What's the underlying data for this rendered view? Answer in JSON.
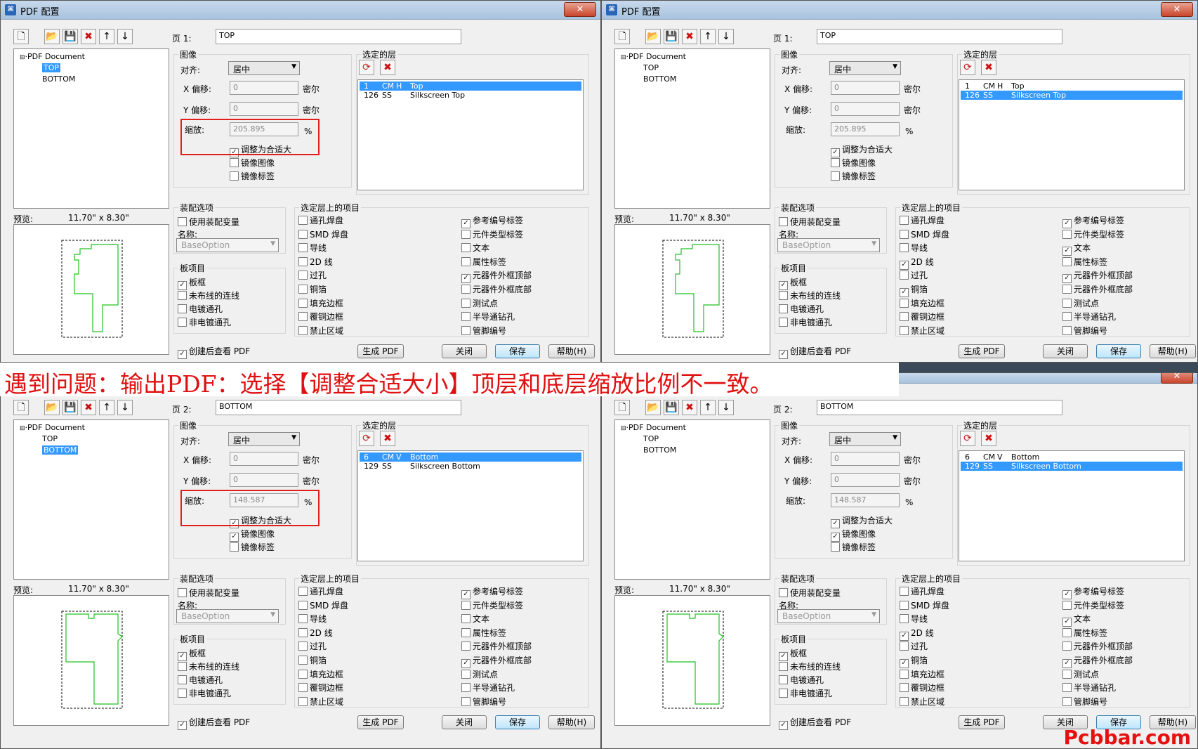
{
  "window": {
    "title": "PDF 配置",
    "close": "✕"
  },
  "banner": "遇到问题：输出PDF：选择【调整合适大小】顶层和底层缩放比例不一致。",
  "watermark": "Pcbbar.com",
  "labels": {
    "image": "图像",
    "align": "对齐:",
    "xoff": "X 偏移:",
    "yoff": "Y 偏移:",
    "unit": "密尔",
    "scale": "缩放:",
    "pct": "%",
    "fit": "调整为合适大",
    "mirror_img": "镜像图像",
    "mirror_lbl": "镜像标签",
    "layers": "选定的层",
    "asm": "装配选项",
    "asm_var": "使用装配变量",
    "name": "名称:",
    "board": "板项目",
    "items": "选定层上的项目",
    "preview": "预览:",
    "view_after": "创建后查看 PDF",
    "gen": "生成 PDF",
    "close": "关闭",
    "save": "保存",
    "help": "帮助(H)",
    "align_value": "居中",
    "base_option": "BaseOption",
    "tree_root": "PDF Document",
    "tree_top": "TOP",
    "tree_bottom": "BOTTOM"
  },
  "board_items": [
    "板框",
    "未布线的连线",
    "电镀通孔",
    "非电镀通孔"
  ],
  "item_col1": [
    "通孔焊盘",
    "SMD 焊盘",
    "导线",
    "2D 线",
    "过孔",
    "铜箔",
    "填充边框",
    "覆铜边框",
    "禁止区域"
  ],
  "item_col2": [
    "参考编号标签",
    "元件类型标签",
    "文本",
    "属性标签",
    "元器件外框顶部",
    "元器件外框底部",
    "测试点",
    "半导通钻孔",
    "管脚编号"
  ],
  "dialogs": [
    {
      "page_label": "页 1:",
      "page_value": "TOP",
      "tree_sel": "top",
      "size": "11.70\" x 8.30\"",
      "x_off": "0",
      "y_off": "0",
      "scale": "205.895",
      "fit": true,
      "mirror_img": false,
      "mirror_lbl": false,
      "layers": [
        {
          "num": "1",
          "code": "CM",
          "dir": "H",
          "name": "Top",
          "sel": true
        },
        {
          "num": "126",
          "code": "SS",
          "dir": "",
          "name": "Silkscreen Top",
          "sel": false
        }
      ],
      "board_checks": [
        true,
        false,
        false,
        false
      ],
      "col1_checks": [
        false,
        false,
        false,
        false,
        false,
        false,
        false,
        false,
        false
      ],
      "col2_checks": [
        true,
        false,
        false,
        false,
        true,
        false,
        false,
        false,
        false
      ],
      "highlight": true,
      "preview_mirror": false
    },
    {
      "page_label": "页 1:",
      "page_value": "TOP",
      "tree_sel": "none",
      "size": "11.70\" x 8.30\"",
      "x_off": "0",
      "y_off": "0",
      "scale": "205.895",
      "fit": true,
      "mirror_img": false,
      "mirror_lbl": false,
      "layers": [
        {
          "num": "1",
          "code": "CM",
          "dir": "H",
          "name": "Top",
          "sel": false
        },
        {
          "num": "126",
          "code": "SS",
          "dir": "",
          "name": "Silkscreen Top",
          "sel": true
        }
      ],
      "board_checks": [
        true,
        false,
        false,
        false
      ],
      "col1_checks": [
        false,
        false,
        false,
        true,
        false,
        true,
        false,
        false,
        false
      ],
      "col2_checks": [
        true,
        false,
        true,
        false,
        true,
        false,
        false,
        false,
        false
      ],
      "highlight": false,
      "preview_mirror": false
    },
    {
      "page_label": "页 2:",
      "page_value": "BOTTOM",
      "tree_sel": "bottom",
      "size": "11.70\" x 8.30\"",
      "x_off": "0",
      "y_off": "0",
      "scale": "148.587",
      "fit": true,
      "mirror_img": true,
      "mirror_lbl": false,
      "layers": [
        {
          "num": "6",
          "code": "CM",
          "dir": "V",
          "name": "Bottom",
          "sel": true
        },
        {
          "num": "129",
          "code": "SS",
          "dir": "",
          "name": "Silkscreen Bottom",
          "sel": false
        }
      ],
      "board_checks": [
        true,
        false,
        false,
        false
      ],
      "col1_checks": [
        false,
        false,
        false,
        false,
        false,
        false,
        false,
        false,
        false
      ],
      "col2_checks": [
        true,
        false,
        false,
        false,
        false,
        true,
        false,
        false,
        false
      ],
      "highlight": true,
      "preview_mirror": true
    },
    {
      "page_label": "页 2:",
      "page_value": "BOTTOM",
      "tree_sel": "none",
      "size": "11.70\" x 8.30\"",
      "x_off": "0",
      "y_off": "0",
      "scale": "148.587",
      "fit": true,
      "mirror_img": true,
      "mirror_lbl": false,
      "layers": [
        {
          "num": "6",
          "code": "CM",
          "dir": "V",
          "name": "Bottom",
          "sel": false
        },
        {
          "num": "129",
          "code": "SS",
          "dir": "",
          "name": "Silkscreen Bottom",
          "sel": true
        }
      ],
      "board_checks": [
        true,
        false,
        false,
        false
      ],
      "col1_checks": [
        false,
        false,
        false,
        true,
        false,
        true,
        false,
        false,
        false
      ],
      "col2_checks": [
        true,
        false,
        true,
        false,
        false,
        true,
        false,
        false,
        false
      ],
      "highlight": false,
      "preview_mirror": true
    }
  ]
}
